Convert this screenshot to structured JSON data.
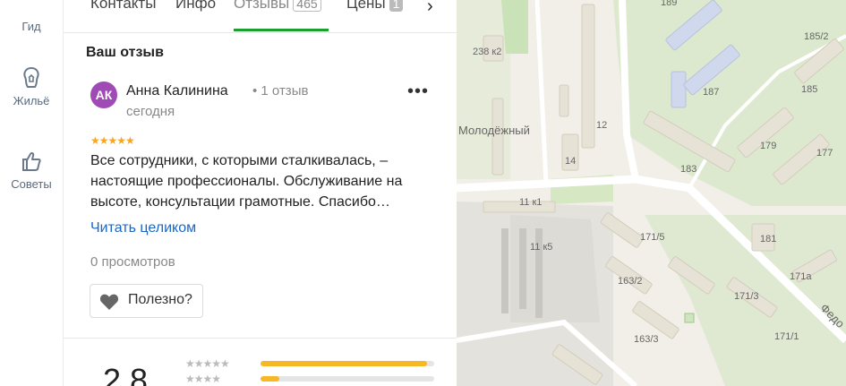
{
  "sidebar": {
    "items": [
      {
        "label": "Гид",
        "icon": "guide-icon"
      },
      {
        "label": "Жильё",
        "icon": "housing-icon"
      },
      {
        "label": "Советы",
        "icon": "thumbs-up-icon"
      }
    ]
  },
  "tabs": [
    {
      "label": "Контакты",
      "count": ""
    },
    {
      "label": "Инфо",
      "count": ""
    },
    {
      "label": "Отзывы",
      "count": "465",
      "active": true
    },
    {
      "label": "Цены",
      "count": "1"
    }
  ],
  "review": {
    "section_title": "Ваш отзыв",
    "avatar_initials": "АК",
    "avatar_color": "#a04bb5",
    "author": "Анна Калинина",
    "author_meta": "• 1 отзыв",
    "date": "сегодня",
    "rating": 5,
    "stars_text": "★★★★★",
    "text": "Все сотрудники, с которыми сталкивалась, – настоящие профессионалы. Обслуживание на высоте, консультации грамотные. Спасибо…",
    "read_more": "Читать целиком",
    "views": "0 просмотров",
    "useful_label": "Полезно?"
  },
  "summary": {
    "rating_big": "2,8",
    "rows": [
      {
        "stars": "★★★★★",
        "fill_percent": 96
      },
      {
        "stars": "★★★★",
        "fill_percent": 11
      }
    ]
  },
  "map": {
    "labels": [
      "189",
      "185/2",
      "238 к2",
      "187",
      "185",
      "Молодёжный",
      "12",
      "179",
      "177",
      "14",
      "183",
      "11 к1",
      "171/5",
      "181",
      "11 к5",
      "171а",
      "163/2",
      "171/3",
      "163/3",
      "171/1",
      "Федо"
    ]
  },
  "colors": {
    "accent_green": "#1aa02d",
    "link_blue": "#1a67c5",
    "star_orange": "#f6a623"
  }
}
